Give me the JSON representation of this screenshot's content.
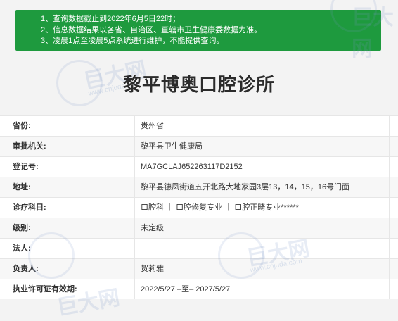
{
  "notice": {
    "line1": "1、查询数据截止到2022年6月5日22时；",
    "line2": "2、信息数据结果以各省、自治区、直辖市卫生健康委数据为准。",
    "line3": "3、凌晨1点至凌晨5点系统进行维护，不能提供查询。"
  },
  "page_title": "黎平博奥口腔诊所",
  "watermark": {
    "brand": "巨大网",
    "site": "www.cnjuda.com"
  },
  "rows": [
    {
      "label": "省份:",
      "value": "贵州省"
    },
    {
      "label": "审批机关:",
      "value": "黎平县卫生健康局"
    },
    {
      "label": "登记号:",
      "value": "MA7GCLAJ652263117D2152"
    },
    {
      "label": "地址:",
      "value": "黎平县德凤街道五开北路大地家园3层13，14，15，16号门面"
    },
    {
      "label": "诊疗科目:",
      "value": "口腔科 ｜ 口腔修复专业 ｜ 口腔正畸专业******"
    },
    {
      "label": "级别:",
      "value": "未定级"
    },
    {
      "label": "法人:",
      "value": ""
    },
    {
      "label": "负责人:",
      "value": "贺莉雅"
    },
    {
      "label": "执业许可证有效期:",
      "value": "2022/5/27 –至– 2027/5/27"
    }
  ]
}
